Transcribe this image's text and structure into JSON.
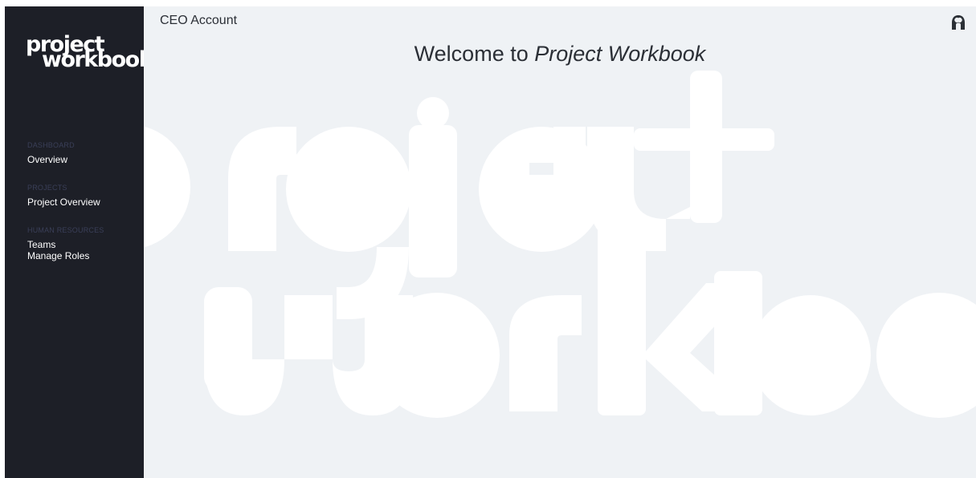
{
  "app": {
    "logo_line1": "project",
    "logo_line2": "workbook"
  },
  "sidebar": {
    "sections": [
      {
        "header": "DASHBOARD",
        "items": [
          "Overview"
        ]
      },
      {
        "header": "PROJECTS",
        "items": [
          "Project Overview"
        ]
      },
      {
        "header": "HUMAN RESOURCES",
        "items": [
          "Teams",
          "Manage Roles"
        ]
      }
    ]
  },
  "header": {
    "account_label": "CEO Account",
    "user_icon": "user-avatar-icon"
  },
  "main": {
    "welcome_prefix": "Welcome to ",
    "welcome_app_name": "Project Workbook",
    "watermark_line1": "project",
    "watermark_line2": "workbook"
  },
  "colors": {
    "sidebar_bg": "#1d1f27",
    "main_bg": "#eff2f5",
    "section_header": "#3a3f58",
    "text_dark": "#2b2f36",
    "watermark": "#ffffff"
  }
}
